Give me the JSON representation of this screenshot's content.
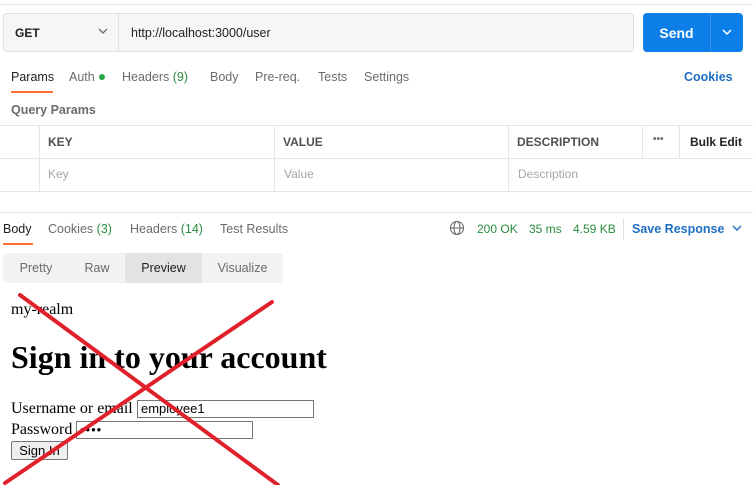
{
  "request": {
    "method": "GET",
    "url": "http://localhost:3000/user",
    "send_label": "Send"
  },
  "request_tabs": {
    "params": "Params",
    "auth": "Auth",
    "headers": "Headers",
    "headers_count": "(9)",
    "body": "Body",
    "prereq": "Pre-req.",
    "tests": "Tests",
    "settings": "Settings",
    "cookies": "Cookies"
  },
  "query_params": {
    "title": "Query Params",
    "headers": [
      "KEY",
      "VALUE",
      "DESCRIPTION"
    ],
    "more": "•••",
    "bulk_edit": "Bulk Edit",
    "placeholders": {
      "key": "Key",
      "value": "Value",
      "description": "Description"
    }
  },
  "response_tabs": {
    "body": "Body",
    "cookies": "Cookies",
    "cookies_count": "(3)",
    "headers": "Headers",
    "headers_count": "(14)",
    "test_results": "Test Results"
  },
  "response_status": {
    "code": "200 OK",
    "time": "35 ms",
    "size": "4.59 KB",
    "save": "Save Response"
  },
  "view_modes": {
    "pretty": "Pretty",
    "raw": "Raw",
    "preview": "Preview",
    "visualize": "Visualize",
    "selected": "Preview"
  },
  "preview": {
    "realm": "my-realm",
    "heading": "Sign in to your account",
    "username_label": "Username or email",
    "username_value": "employee1",
    "password_label": "Password",
    "password_value": "••••",
    "signin_button": "Sign In"
  },
  "colors": {
    "accent_orange": "#ff6c37",
    "send_blue": "#0c7ee8",
    "link_blue": "#1f6fc4",
    "status_green": "#2a8c3f",
    "cross_red": "#e0202a"
  },
  "icons": {
    "method_dropdown": "chevron-down-icon",
    "send_dropdown": "chevron-down-icon",
    "globe": "globe-icon",
    "save_dropdown": "chevron-down-icon"
  }
}
